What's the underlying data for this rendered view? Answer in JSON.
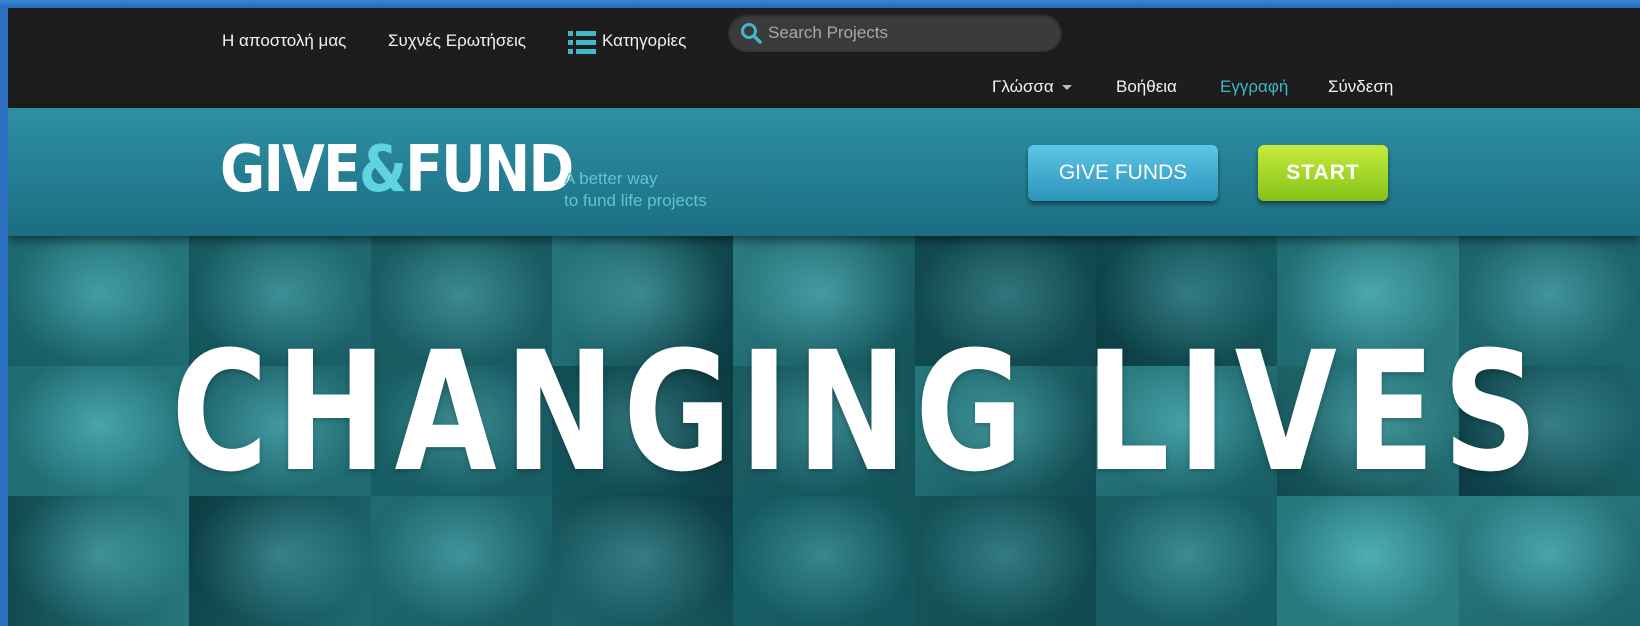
{
  "nav": {
    "mission": "Η αποστολή μας",
    "faq": "Συχνές Ερωτήσεις",
    "categories": "Κατηγορίες",
    "search_placeholder": "Search Projects",
    "language": "Γλώσσα",
    "help": "Βοήθεια",
    "register": "Εγγραφή",
    "login": "Σύνδεση"
  },
  "brand": {
    "logo_give": "GIVE",
    "logo_amp": "&",
    "logo_fund": "FUND",
    "tagline_line1": "A better way",
    "tagline_line2": "to fund life projects"
  },
  "actions": {
    "give_funds": "GIVE FUNDS",
    "start": "START"
  },
  "hero": {
    "title": "CHANGING LIVES"
  },
  "colors": {
    "accent": "#3fb8c8",
    "band": "#2e8fa3",
    "start_button": "#a6d82a",
    "give_button": "#3aa9d0",
    "tile_tones": [
      "#1f7d86",
      "#2a8e97",
      "#16636b",
      "#33a0a8",
      "#1a6f78",
      "#27858f",
      "#0f5159",
      "#3aa7ae",
      "#227a83"
    ]
  }
}
